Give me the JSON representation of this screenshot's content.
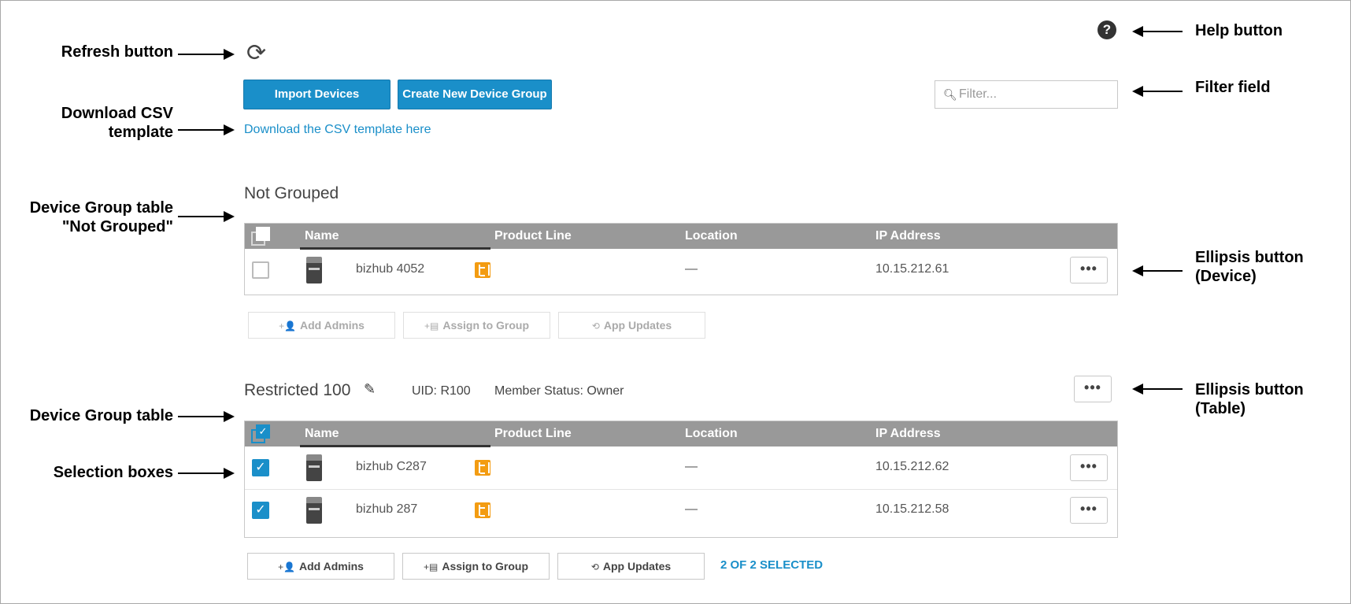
{
  "annotations": {
    "refresh": "Refresh button",
    "download_line1": "Download CSV",
    "download_line2": "template",
    "not_grouped_line1": "Device Group table",
    "not_grouped_line2": "\"Not Grouped\"",
    "device_group_table": "Device Group table",
    "selection_boxes": "Selection boxes",
    "help": "Help button",
    "filter": "Filter field",
    "ellipsis_device_line1": "Ellipsis button",
    "ellipsis_device_line2": "(Device)",
    "ellipsis_table_line1": "Ellipsis button",
    "ellipsis_table_line2": "(Table)"
  },
  "toolbar": {
    "refresh_icon": "refresh-icon",
    "import_label": "Import Devices",
    "create_group_label": "Create New Device Group",
    "download_link": "Download the CSV template here",
    "filter_placeholder": "Filter...",
    "help_icon": "?",
    "accent_color": "#1a8fc9"
  },
  "columns": [
    "Name",
    "Product Line",
    "Location",
    "IP Address"
  ],
  "not_grouped": {
    "title": "Not Grouped",
    "rows": [
      {
        "name": "bizhub 4052",
        "location": "—",
        "ip": "10.15.212.61",
        "checked": false
      }
    ],
    "actions": [
      "Add Admins",
      "Assign to Group",
      "App Updates"
    ]
  },
  "restricted": {
    "title": "Restricted 100",
    "uid": "UID: R100",
    "member_status": "Member Status: Owner",
    "rows": [
      {
        "name": "bizhub C287",
        "location": "—",
        "ip": "10.15.212.62",
        "checked": true
      },
      {
        "name": "bizhub 287",
        "location": "—",
        "ip": "10.15.212.58",
        "checked": true
      }
    ],
    "actions": [
      "Add Admins",
      "Assign to Group",
      "App Updates"
    ],
    "selected_text": "2 OF 2 SELECTED"
  },
  "ellipsis": "•••",
  "checkmark": "✓"
}
